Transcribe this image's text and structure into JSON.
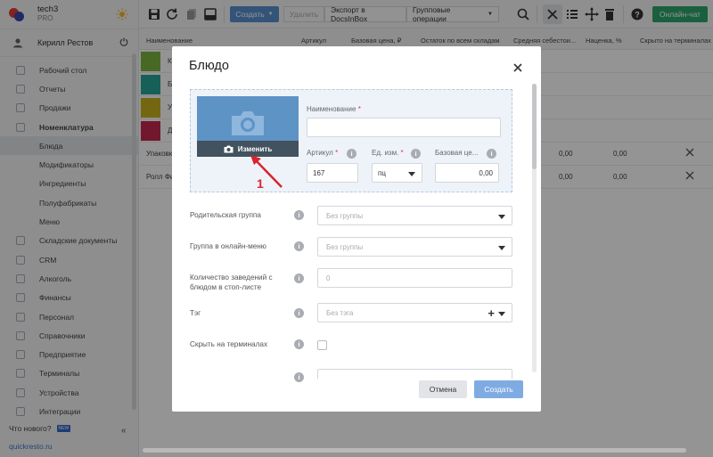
{
  "sidebar": {
    "brand_name": "tech3",
    "brand_plan": "PRO",
    "user_name": "Кирилл Рестов",
    "items": [
      {
        "label": "Рабочий стол",
        "icon": "desktop-icon"
      },
      {
        "label": "Отчеты",
        "icon": "reports-icon"
      },
      {
        "label": "Продажи",
        "icon": "sales-icon"
      },
      {
        "label": "Номенклатура",
        "icon": "nomenclature-icon"
      },
      {
        "label": "Блюда",
        "icon": ""
      },
      {
        "label": "Модификаторы",
        "icon": ""
      },
      {
        "label": "Ингредиенты",
        "icon": ""
      },
      {
        "label": "Полуфабрикаты",
        "icon": ""
      },
      {
        "label": "Меню",
        "icon": ""
      },
      {
        "label": "Складские документы",
        "icon": "warehouse-icon"
      },
      {
        "label": "CRM",
        "icon": "crm-icon"
      },
      {
        "label": "Алкоголь",
        "icon": "alcohol-icon"
      },
      {
        "label": "Финансы",
        "icon": "finance-icon"
      },
      {
        "label": "Персонал",
        "icon": "staff-icon"
      },
      {
        "label": "Справочники",
        "icon": "reference-icon"
      },
      {
        "label": "Предприятие",
        "icon": "enterprise-icon"
      },
      {
        "label": "Терминалы",
        "icon": "terminal-icon"
      },
      {
        "label": "Устройства",
        "icon": "devices-icon"
      },
      {
        "label": "Интеграции",
        "icon": "integrations-icon"
      }
    ],
    "whats_new": "Что нового?",
    "new_badge": "NEW",
    "site_link": "quickresto.ru"
  },
  "toolbar": {
    "create_label": "Создать",
    "delete_label": "Удалить",
    "export_label": "Экспорт в DocsInBox",
    "group_ops_label": "Групповые операции",
    "chat_label": "Онлайн-чат"
  },
  "table": {
    "headers": [
      "Наименование",
      "Артикул",
      "Базовая цена, ₽",
      "Остаток по всем складам",
      "Средняя себестои...",
      "Наценка, %",
      "Скрыто на терминалах"
    ],
    "rows": [
      {
        "name": "К",
        "c1": "",
        "c2": ""
      },
      {
        "name": "Б",
        "c1": "",
        "c2": ""
      },
      {
        "name": "У",
        "c1": "",
        "c2": ""
      },
      {
        "name": "Д",
        "c1": "",
        "c2": ""
      },
      {
        "name": "Упаковк",
        "c1": "0,00",
        "c2": "0,00"
      },
      {
        "name": "Ролл Фи",
        "c1": "0,00",
        "c2": "0,00"
      }
    ]
  },
  "modal": {
    "title": "Блюдо",
    "photo_change": "Изменить",
    "name_label": "Наименование",
    "name_value": "",
    "article_label": "Артикул",
    "article_value": "167",
    "unit_label": "Ед. изм.",
    "unit_value": "пц",
    "base_price_label": "Базовая це...",
    "base_price_value": "0,00",
    "required_mark": "*",
    "parent_group_label": "Родительская группа",
    "parent_group_value": "Без группы",
    "online_menu_label": "Группа в онлайн-меню",
    "online_menu_value": "Без группы",
    "stoplist_label": "Количество заведений с блюдом в стоп-листе",
    "stoplist_value": "0",
    "tag_label": "Тэг",
    "tag_value": "Без тэга",
    "hide_terminals_label": "Скрыть на терминалах",
    "cancel_label": "Отмена",
    "submit_label": "Создать"
  },
  "annotation": {
    "number": "1",
    "color": "#d9242b"
  }
}
